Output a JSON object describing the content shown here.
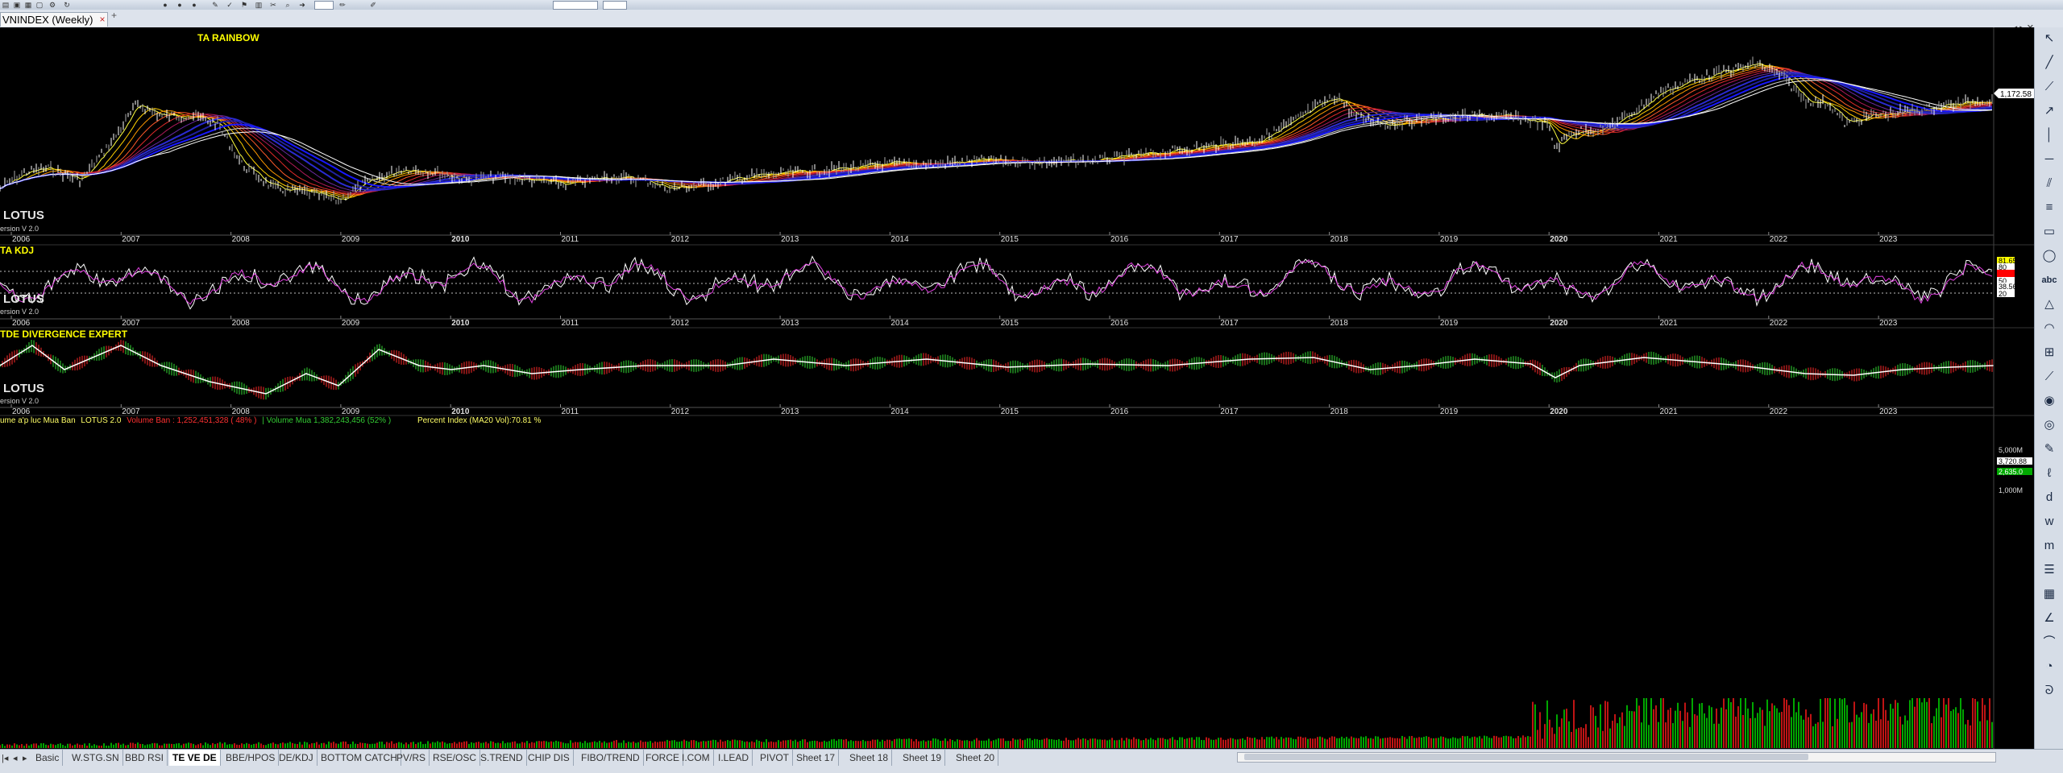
{
  "document_tab": {
    "label": "VNINDEX (Weekly)",
    "close_label": "×",
    "add_label": "+"
  },
  "window_controls": {
    "label": "◂ ▸ ✕"
  },
  "colors": {
    "background": "#000000",
    "grid": "#2a2a2a",
    "axis_text": "#dddddd",
    "title": "#ffff00",
    "kdj_purple": "#e040e0",
    "price_label_bg": "#ffffff",
    "volume_green": "#00dd00",
    "volume_red": "#ff1a1a"
  },
  "years": [
    "2006",
    "2007",
    "2008",
    "2009",
    "2010",
    "2011",
    "2012",
    "2013",
    "2014",
    "2015",
    "2016",
    "2017",
    "2018",
    "2019",
    "2020",
    "2021",
    "2022",
    "2023"
  ],
  "bold_years": [
    "2010",
    "2020"
  ],
  "panes": {
    "rainbow": {
      "title": "TA RAINBOW",
      "watermark": "LOTUS",
      "version": "ersion V 2.0",
      "last_price": "1,172.58"
    },
    "kdj": {
      "title": "TA KDJ",
      "watermark": "LOTUS",
      "version": "ersion V 2.0",
      "labels": [
        "81.65",
        "80",
        "",
        "50",
        "38.56",
        "20"
      ]
    },
    "divergence": {
      "title": "TDE DIVERGENCE EXPERT",
      "watermark": "LOTUS",
      "version": "ersion V 2.0"
    },
    "volume": {
      "title_prefix": "ume a'p luc Mua Ban",
      "title_brand": "LOTUS 2.0",
      "sell_text": "Volume Ban : 1,252,451,328 ( 48% )",
      "buy_text": "| Volume Mua 1,382,243,456 (52% )",
      "percent_text": "Percent Index (MA20 Vol):70.81 %",
      "axis_labels": [
        "5,000M",
        "3,720.88",
        "2,635.0",
        "1,000M"
      ]
    }
  },
  "sheet_tabs": [
    "Basic",
    "W.STG.SN",
    "BBD RSI",
    "TE VE DE",
    "BBE/HPOS",
    "DE/KDJ",
    "BOTTOM CATCH",
    "PV/RS",
    "RSE/OSC",
    "S.TREND",
    "CHIP DIS",
    "FIBO/TREND",
    "FORCE",
    "I.COM",
    "I.LEAD",
    "PIVOT",
    "Sheet 17",
    "Sheet 18",
    "Sheet 19",
    "Sheet 20"
  ],
  "active_sheet": "TE VE DE",
  "right_tools": [
    "cursor-icon",
    "line-icon",
    "ray-icon",
    "arrow-line-icon",
    "vertical-line-icon",
    "horizontal-line-icon",
    "parallel-icon",
    "fib-icon",
    "rect-icon",
    "ellipse-icon",
    "text-icon",
    "triangle-icon",
    "arc-icon",
    "gann-icon",
    "trend-icon",
    "globe-icon",
    "lock-icon",
    "pen-icon",
    "brush-icon",
    "d-icon",
    "w-icon",
    "m-icon",
    "bars-icon",
    "grid-icon",
    "angle-icon",
    "fan-icon",
    "cycle-icon",
    "spiral-icon"
  ]
}
